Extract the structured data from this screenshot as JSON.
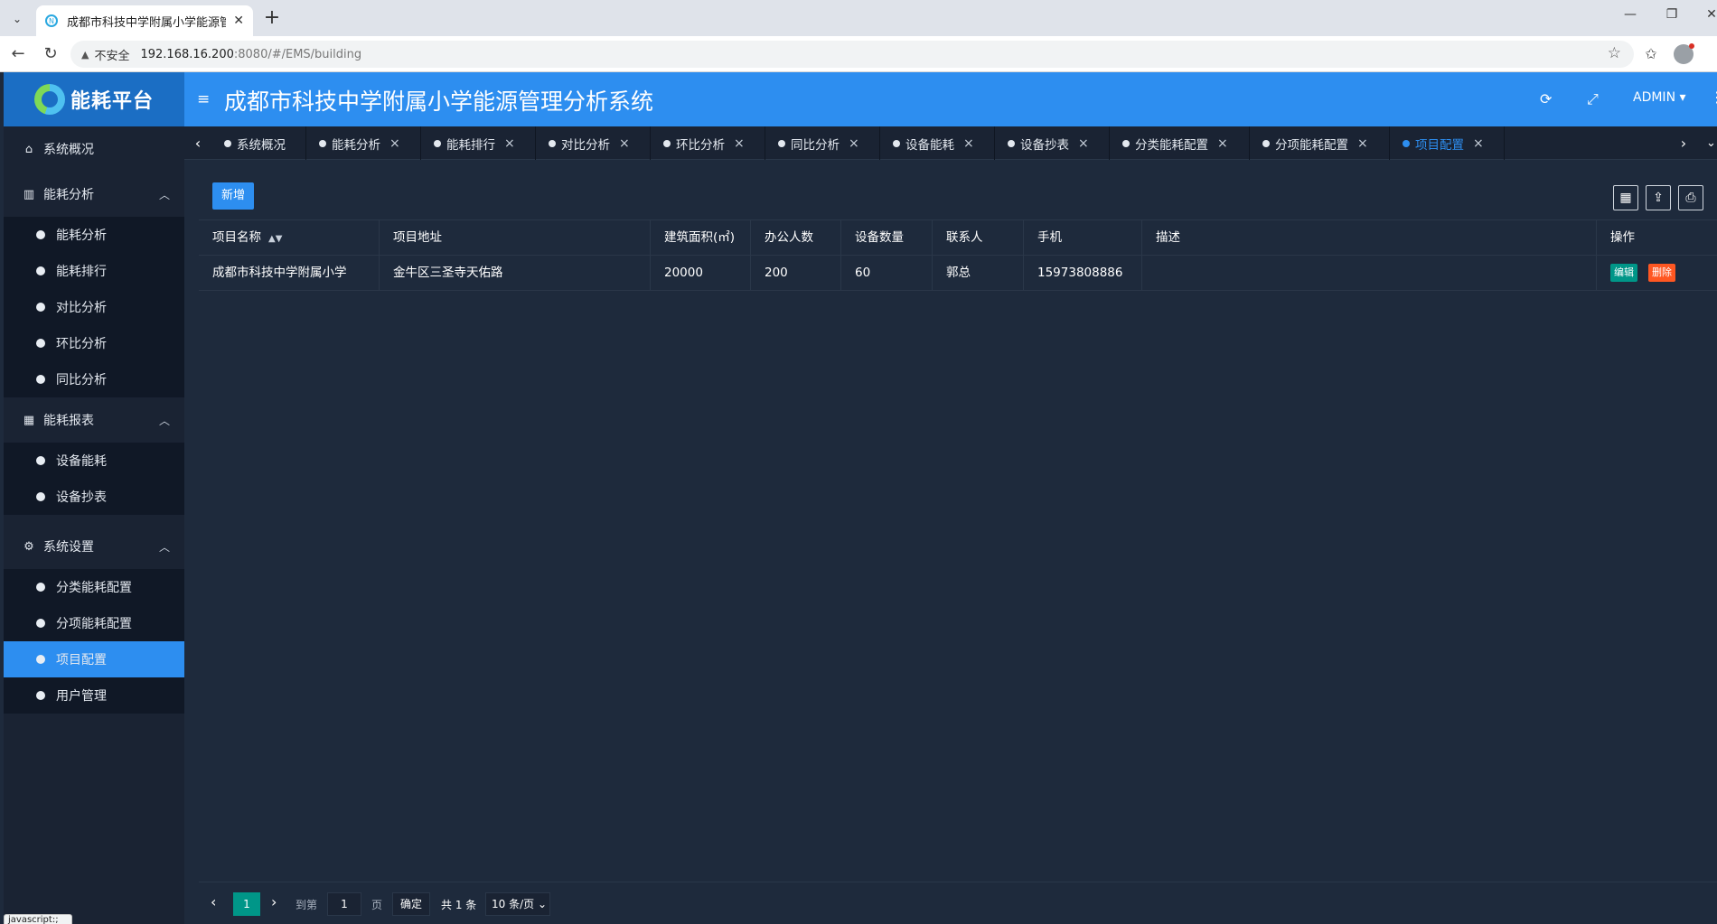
{
  "browser": {
    "tab_title": "成都市科技中学附属小学能源管理",
    "address": {
      "security_label": "不安全",
      "host": "192.168.16.200",
      "path": ":8080/#/EMS/building"
    },
    "status_text": "javascript:;"
  },
  "header": {
    "logo_text": "能耗平台",
    "app_title": "成都市科技中学附属小学能源管理分析系统",
    "user": "ADMIN"
  },
  "sidebar": {
    "overview": "系统概况",
    "groups": [
      {
        "label": "能耗分析",
        "items": [
          "能耗分析",
          "能耗排行",
          "对比分析",
          "环比分析",
          "同比分析"
        ]
      },
      {
        "label": "能耗报表",
        "items": [
          "设备能耗",
          "设备抄表"
        ]
      },
      {
        "label": "系统设置",
        "items": [
          "分类能耗配置",
          "分项能耗配置",
          "项目配置",
          "用户管理"
        ]
      }
    ],
    "active_item": "项目配置"
  },
  "tabs": [
    "系统概况",
    "能耗分析",
    "能耗排行",
    "对比分析",
    "环比分析",
    "同比分析",
    "设备能耗",
    "设备抄表",
    "分类能耗配置",
    "分项能耗配置",
    "项目配置"
  ],
  "toolbar": {
    "add_label": "新增"
  },
  "table": {
    "columns": [
      "项目名称",
      "项目地址",
      "建筑面积(㎡)",
      "办公人数",
      "设备数量",
      "联系人",
      "手机",
      "描述",
      "操作"
    ],
    "rows": [
      [
        "成都市科技中学附属小学",
        "金牛区三圣寺天佑路",
        "20000",
        "200",
        "60",
        "郭总",
        "15973808886",
        ""
      ]
    ],
    "actions": {
      "edit": "编辑",
      "delete": "删除"
    }
  },
  "pagination": {
    "current_page": "1",
    "goto_label": "到第",
    "goto_value": "1",
    "page_suffix": "页",
    "confirm": "确定",
    "total": "共 1 条",
    "page_size": "10 条/页"
  }
}
